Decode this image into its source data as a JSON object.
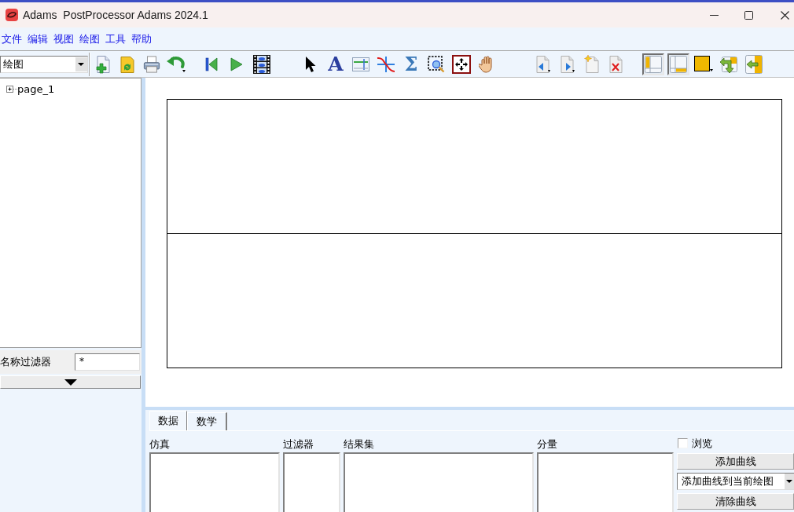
{
  "window": {
    "title": "Adams  PostProcessor Adams 2024.1"
  },
  "menu": [
    {
      "label": "文件"
    },
    {
      "label": "编辑"
    },
    {
      "label": "视图"
    },
    {
      "label": "绘图"
    },
    {
      "label": "工具"
    },
    {
      "label": "帮助"
    }
  ],
  "toolbar": {
    "mode_select": "绘图",
    "text_tool": "A",
    "sum_tool": "Σ",
    "layout_buttons": [
      {
        "pressed": true
      },
      {
        "pressed": true
      }
    ]
  },
  "tree": {
    "items": [
      {
        "label": "page_1",
        "expanded": false
      }
    ]
  },
  "name_filter": {
    "label": "名称过滤器",
    "value": "*"
  },
  "bottom_panel": {
    "tabs": [
      {
        "label": "数据",
        "selected": true
      },
      {
        "label": "数学",
        "selected": false
      }
    ],
    "lists": [
      {
        "label": "仿真"
      },
      {
        "label": "过滤器"
      },
      {
        "label": "结果集"
      },
      {
        "label": "分量"
      }
    ],
    "browse": {
      "label": "浏览",
      "checked": false
    },
    "add_curve_button": "添加曲线",
    "add_mode_select": "添加曲线到当前绘图",
    "clear_button": "清除曲线"
  }
}
